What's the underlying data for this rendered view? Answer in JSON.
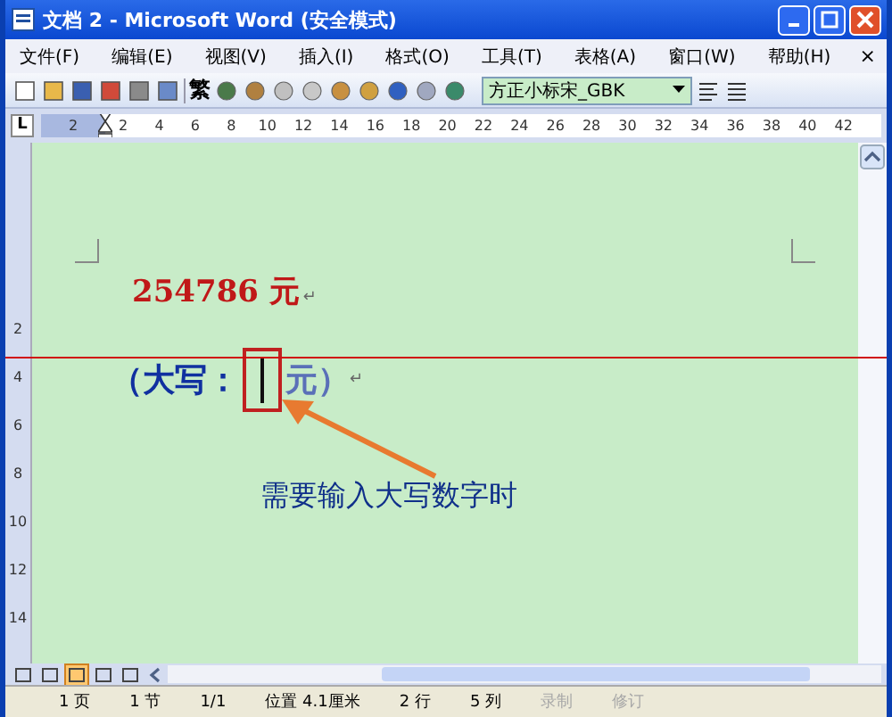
{
  "window": {
    "title": "文档 2 - Microsoft Word (安全模式)"
  },
  "menu": [
    "文件(F)",
    "编辑(E)",
    "视图(V)",
    "插入(I)",
    "格式(O)",
    "工具(T)",
    "表格(A)",
    "窗口(W)",
    "帮助(H)"
  ],
  "menu_close": "×",
  "toolbar": {
    "traditional_chinese": "繁",
    "font": "方正小标宋_GBK"
  },
  "ruler": {
    "tab_stop": "L",
    "left_label": "2",
    "labels": [
      "2",
      "4",
      "6",
      "8",
      "10",
      "12",
      "14",
      "16",
      "18",
      "20",
      "22",
      "24",
      "26",
      "28",
      "30",
      "32",
      "34",
      "36",
      "38",
      "40",
      "42"
    ]
  },
  "vertical_ruler": {
    "labels": [
      "2",
      "4",
      "6",
      "8",
      "10",
      "12",
      "14"
    ]
  },
  "document": {
    "amount": "254786 元",
    "amount_mark": "↵",
    "uppercase_open": "（大写：",
    "uppercase_close": "元）",
    "uppercase_mark": "↵",
    "callout": "需要输入大写数字时"
  },
  "views": [
    {
      "selected": false
    },
    {
      "selected": false
    },
    {
      "selected": true
    },
    {
      "selected": false
    },
    {
      "selected": false
    }
  ],
  "status_bar": [
    {
      "text": "1 页",
      "disabled": false
    },
    {
      "text": "1 节",
      "disabled": false
    },
    {
      "text": "1/1",
      "disabled": false
    },
    {
      "text": "位置 4.1厘米",
      "disabled": false
    },
    {
      "text": "2 行",
      "disabled": false
    },
    {
      "text": "5 列",
      "disabled": false
    },
    {
      "text": "录制",
      "disabled": true
    },
    {
      "text": "修订",
      "disabled": true
    }
  ]
}
